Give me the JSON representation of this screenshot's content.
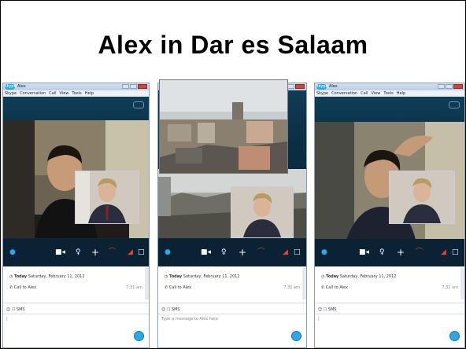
{
  "slide": {
    "title": "Alex in Dar es Salaam"
  },
  "window": {
    "app_badge": "skype",
    "title": "Alex",
    "menu": [
      "Skype",
      "Conversation",
      "Call",
      "View",
      "Tools",
      "Help"
    ],
    "history": {
      "day_label": "Today",
      "date": "Saturday, February 11, 2012",
      "call_label": "Call to Alex",
      "call_time": "7:31 am"
    },
    "sms_label": "SMS",
    "message_placeholder": "Type a message to Alex here"
  },
  "colors": {
    "skype_blue": "#2aa9e6",
    "end_call_red": "#e2413a",
    "call_bg": "#0b2e44"
  },
  "icons": [
    "chat-icon",
    "video-camera-icon",
    "microphone-icon",
    "plus-icon",
    "end-call-icon",
    "signal-icon",
    "fullscreen-icon",
    "send-icon",
    "emoticon-icon",
    "clock-icon",
    "phone-icon"
  ]
}
